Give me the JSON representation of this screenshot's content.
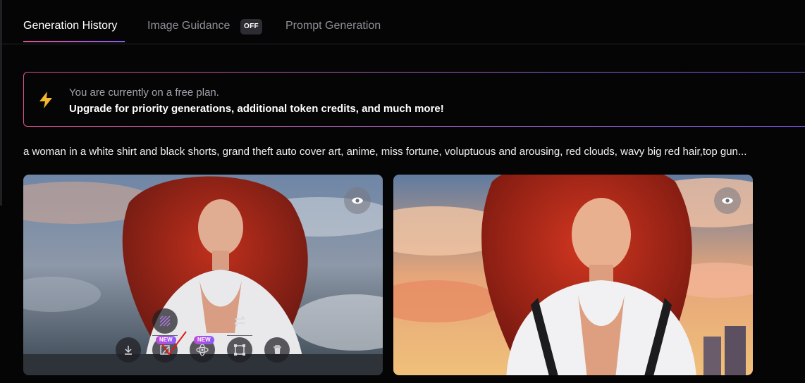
{
  "tabs": [
    {
      "label": "Generation History",
      "active": true
    },
    {
      "label": "Image Guidance",
      "badge": "OFF"
    },
    {
      "label": "Prompt Generation"
    }
  ],
  "upgrade": {
    "line1": "You are currently on a free plan.",
    "line2": "Upgrade for priority generations, additional token credits, and much more!",
    "icon": "lightning-bolt-icon",
    "accent_color": "#f5b731"
  },
  "prompt_text": "a woman in a white shirt and black shorts, grand theft auto cover art, anime, miss fortune, voluptuous and arousing, red clouds, wavy big red hair,top gun...",
  "image_toolbar": {
    "new_badge": "NEW",
    "tools": [
      "download-icon",
      "canvas-edit-icon",
      "motion-icon",
      "crop-icon",
      "delete-icon",
      "remove-background-icon",
      "flip-icon"
    ]
  },
  "colors": {
    "background": "#050505",
    "tab_gradient_start": "#e0508f",
    "tab_gradient_end": "#8b5cf6"
  }
}
